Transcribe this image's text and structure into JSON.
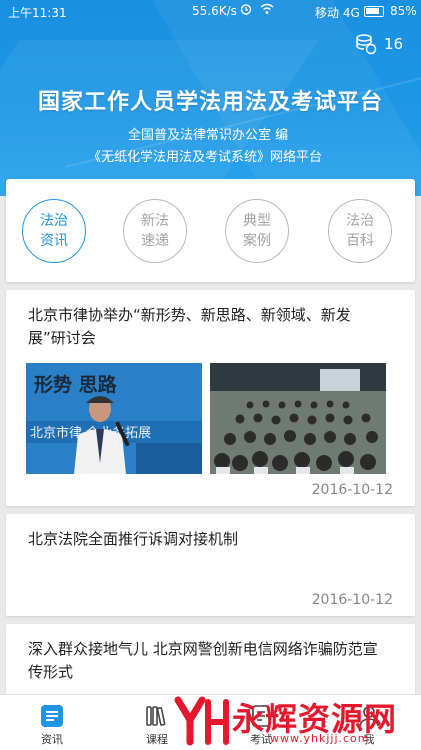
{
  "status_bar": {
    "time": "上午11:31",
    "speed": "55.6K/s",
    "carrier": "移动 4G",
    "battery": "85%"
  },
  "header": {
    "coin_count": "16",
    "title": "国家工作人员学法用法及考试平台",
    "subtitle_line1": "全国普及法律常识办公室 编",
    "subtitle_line2": "《无纸化学法用法及考试系统》网络平台"
  },
  "categories": [
    {
      "line1": "法治",
      "line2": "资讯",
      "active": true
    },
    {
      "line1": "新法",
      "line2": "速递",
      "active": false
    },
    {
      "line1": "典型",
      "line2": "案例",
      "active": false
    },
    {
      "line1": "法治",
      "line2": "百科",
      "active": false
    }
  ],
  "news": [
    {
      "title": "北京市律协举办“新形势、新思路、新领域、新发展”研讨会",
      "date": "2016-10-12",
      "image1_caption": "形势  思路",
      "image1_banner": "北京市律 会业务拓展"
    },
    {
      "title": "北京法院全面推行诉调对接机制",
      "date": "2016-10-12"
    },
    {
      "title": "深入群众接地气儿 北京网警创新电信网络诈骗防范宣传形式"
    }
  ],
  "bottom_nav": [
    {
      "label": "资讯",
      "icon": "news-icon",
      "active": true
    },
    {
      "label": "课程",
      "icon": "books-icon",
      "active": false
    },
    {
      "label": "考试",
      "icon": "exam-icon",
      "active": false
    },
    {
      "label": "我",
      "icon": "profile-icon",
      "active": false
    }
  ],
  "watermark": {
    "text": "永辉资源网",
    "url": "www.yhkjjj.com"
  },
  "colors": {
    "accent": "#1f95e3",
    "header_bg": "#1e98e6",
    "watermark_red": "#e6172c"
  }
}
